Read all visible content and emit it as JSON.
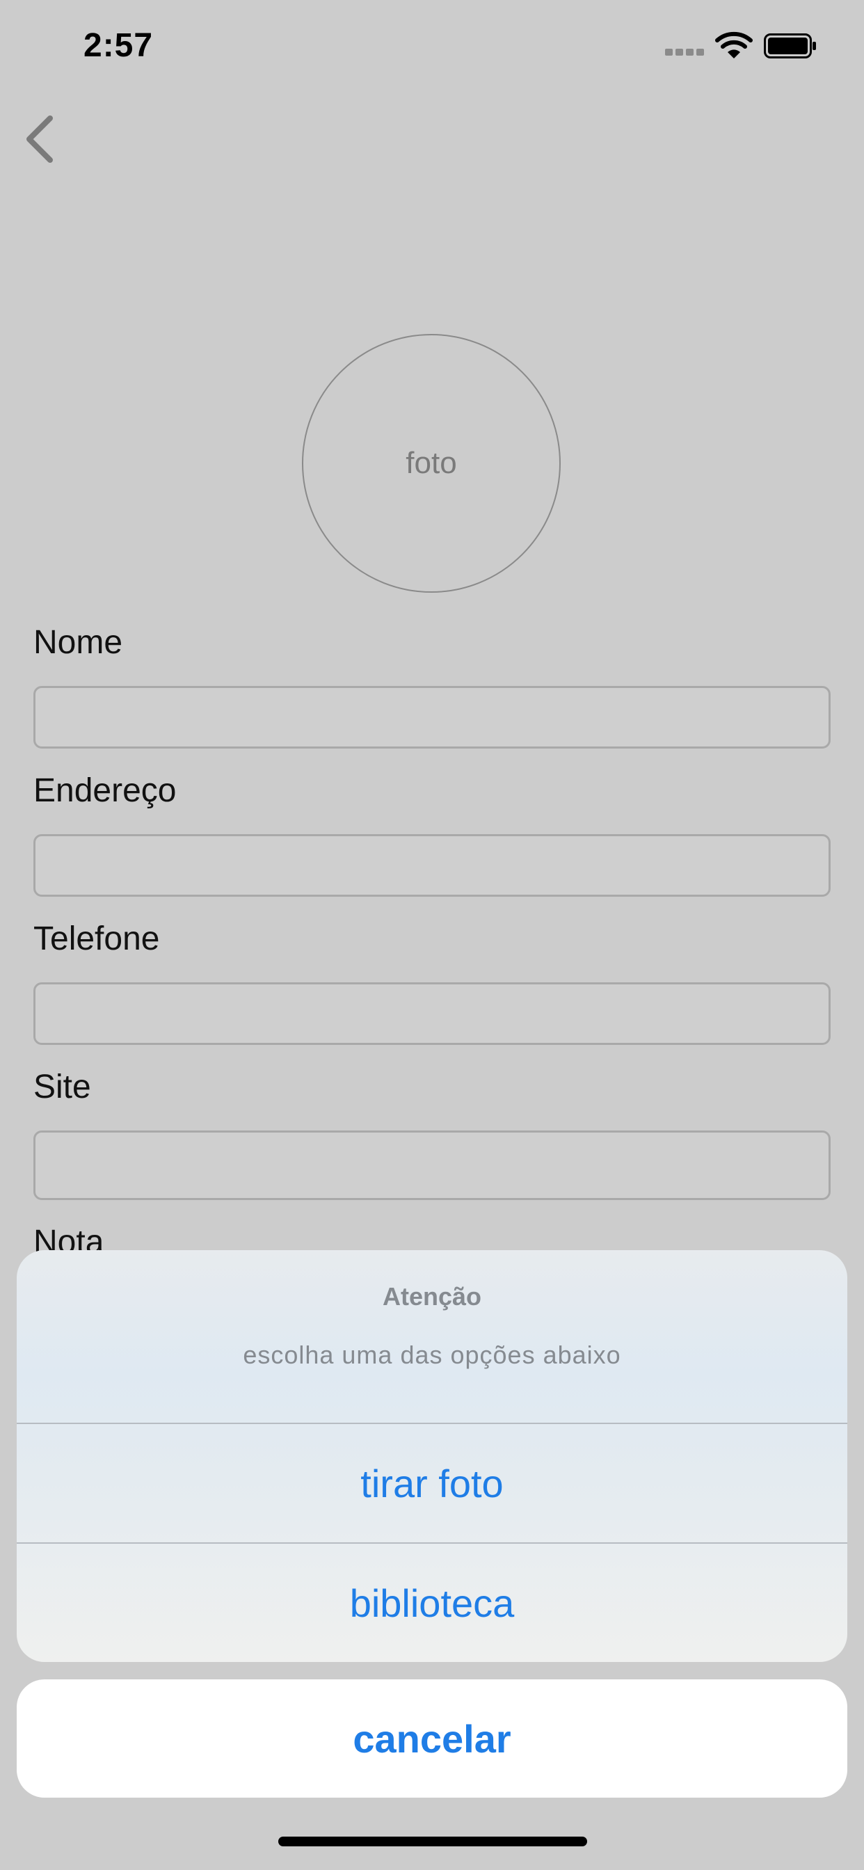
{
  "status_bar": {
    "time": "2:57"
  },
  "icons": {
    "back": "chevron-left-icon",
    "signal": "signal-icon",
    "wifi": "wifi-icon",
    "battery": "battery-icon"
  },
  "photo": {
    "label": "foto"
  },
  "form": {
    "fields": [
      {
        "label": "Nome",
        "value": ""
      },
      {
        "label": "Endereço",
        "value": ""
      },
      {
        "label": "Telefone",
        "value": ""
      },
      {
        "label": "Site",
        "value": ""
      },
      {
        "label": "Nota"
      }
    ]
  },
  "action_sheet": {
    "title": "Atenção",
    "message": "escolha uma das opções abaixo",
    "options": [
      "tirar foto",
      "biblioteca"
    ],
    "cancel": "cancelar"
  },
  "colors": {
    "accent": "#1f7de6",
    "background": "#cccccc",
    "sheet": "#e4ebf0"
  }
}
